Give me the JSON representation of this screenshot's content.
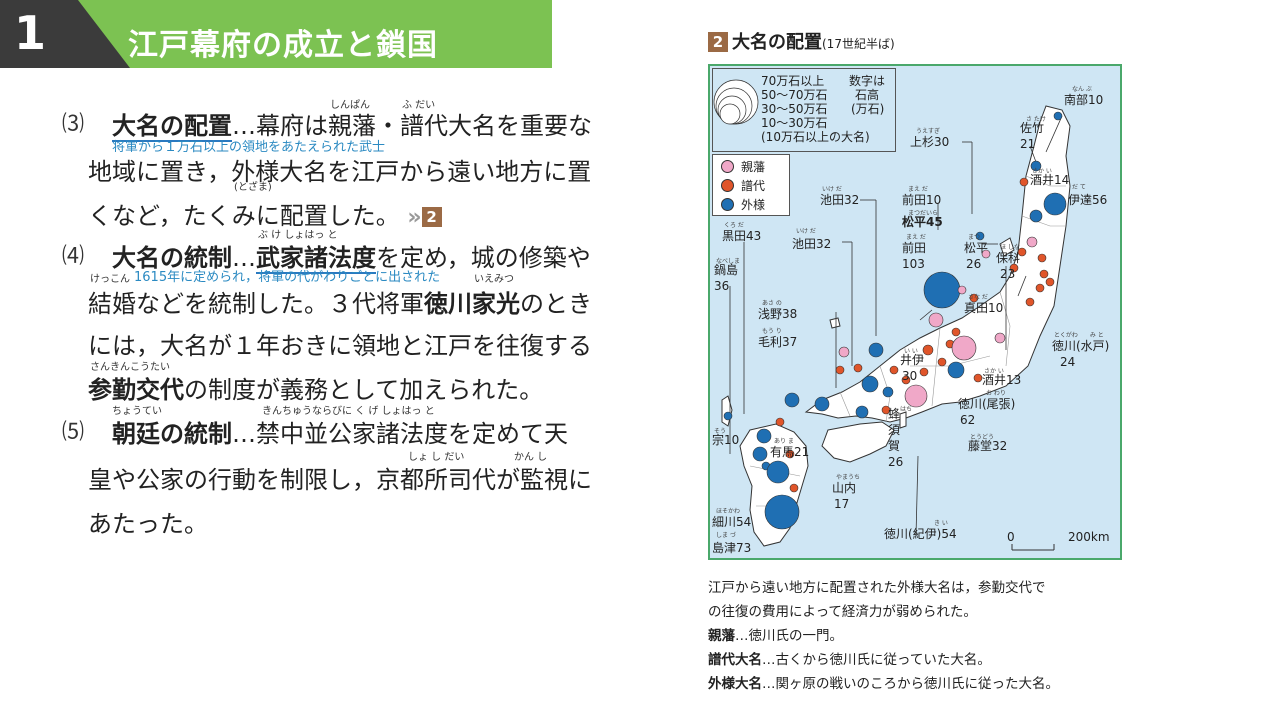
{
  "header": {
    "number": "1",
    "title": "江戸幕府の成立と鎖国"
  },
  "body": {
    "p3": {
      "num": "⑶",
      "head": "大名の配置",
      "l1_rest_a": "…幕府は",
      "shinpan": "親藩",
      "l1_mid": "・",
      "fudai": "譜代",
      "l1_rest_b": "大名を重要な",
      "ruby_shinpan": "しんぱん",
      "ruby_fudai": "ふ だい",
      "note_fudai": "将軍から１万石以上の領地をあたえられた武士",
      "l2_a": "地域に置き，",
      "tozama": "外様",
      "l2_b": "大名を江戸から遠い地方に置",
      "ruby_tozama": "(とざま)",
      "l3": "くなど，たくみに配置した。",
      "ref_arrow": "»",
      "ref_num": "2"
    },
    "p4": {
      "num": "⑷",
      "head": "大名の統制",
      "dots": "…",
      "bukeshohatto": "武家諸法度",
      "ruby_buke": "ぶ け しょはっ と",
      "l1_rest": "を定め，城の修築や",
      "ruby_kekkon": "けっこん",
      "note_buke": "1615年に定められ，将軍の代がわりごとに出された",
      "ruby_iemitsu": "いえみつ",
      "l2_a": "結婚などを統制した。３代将軍",
      "iemitsu": "徳川家光",
      "l2_b": "のとき",
      "l3": "には，大名が１年おきに領地と江戸を往復する",
      "ruby_sankin": "さんきんこうたい",
      "sankin": "参勤交代",
      "l4_rest": "の制度が義務として加えられた。"
    },
    "p5": {
      "num": "⑸",
      "ruby_chotei": "ちょうてい",
      "head": "朝廷の統制",
      "dots": "…",
      "l1_rest": "禁中並公家諸法度を定めて天",
      "ruby_kinchu": "きんちゅうならびに く げ しょはっ と",
      "l2": "皇や公家の行動を制限し，京都所司代が監視に",
      "ruby_shoshidai": "しょ し だい",
      "ruby_kanshi": "かん し",
      "l3": "あたった。"
    }
  },
  "figure": {
    "num": "2",
    "title": "大名の配置",
    "subtitle": "(17世紀半ば)",
    "legend_size": [
      "70万石以上",
      "50〜70万石",
      "30〜50万石",
      "10〜30万石",
      "(10万石以上の大名)"
    ],
    "legend_note": [
      "数字は",
      "石高",
      "(万石)"
    ],
    "legend_types": [
      {
        "label": "親藩",
        "color": "#f0a8c8"
      },
      {
        "label": "譜代",
        "color": "#e0552a"
      },
      {
        "label": "外様",
        "color": "#1f6fb3"
      }
    ],
    "labels": {
      "nanbu": "南部10",
      "satake": "佐竹",
      "satake_n": "21",
      "sakai14": "酒井14",
      "date": "伊達56",
      "uesugi": "上杉30",
      "maeda10": "前田10",
      "matsudaira45": "松平45",
      "ikeda32a": "池田32",
      "kuroda": "黒田43",
      "ikeda32b": "池田32",
      "maeda103": "前田",
      "maeda103_n": "103",
      "matsudaira26": "松平",
      "matsudaira26_n": "26",
      "hoshina": "保科",
      "hoshina_n": "23",
      "nabeshima": "鍋島",
      "nabeshima_n": "36",
      "sanada": "真田10",
      "asano": "浅野38",
      "mori": "毛利37",
      "ii": "井伊",
      "ii_n": "30",
      "mito": "徳川(水戸)",
      "mito_n": "24",
      "sakai13": "酒井13",
      "owari": "徳川(尾張)",
      "owari_n": "62",
      "hachisuka": "蜂",
      "hachisuka2": "須",
      "hachisuka3": "賀",
      "hachisuka_n": "26",
      "so": "宗10",
      "arima": "有馬21",
      "todo": "藤堂32",
      "yamauchi": "山内",
      "yamauchi_n": "17",
      "hosokawa": "細川54",
      "kii": "徳川(紀伊)54",
      "shimazu": "島津73",
      "scale0": "0",
      "scale200": "200km"
    },
    "ruby": {
      "nanbu": "なん ぶ",
      "satake": "さ たけ",
      "sakai14": "さか い",
      "date": "だ て",
      "uesugi": "うえすぎ",
      "maeda10": "まえ だ",
      "matsudaira45": "まつだいら",
      "ikeda32a": "いけ だ",
      "kuroda": "くろ だ",
      "ikeda32b": "いけ だ",
      "maeda103": "まえ だ",
      "matsudaira26": "まつ",
      "hoshina": "ほ しな",
      "nabeshima": "なべしま",
      "sanada": "さな だ",
      "asano": "あさ の",
      "mori": "もう り",
      "ii": "い い",
      "mito": "とくがわ　　み と",
      "sakai13": "さか い",
      "owari": "お わり",
      "hachisuka": "はち",
      "so": "そう",
      "arima": "あり ま",
      "todo": "とうどう",
      "yamauchi": "やまうち",
      "hosokawa": "ほそかわ",
      "kii": "き い",
      "shimazu": "しま づ"
    }
  },
  "caption": {
    "l1": "江戸から遠い地方に配置された外様大名は，参勤交代で",
    "l2": "の往復の費用によって経済力が弱められた。",
    "shinpan_b": "親藩",
    "shinpan_t": "…徳川氏の一門。",
    "fudai_b": "譜代大名",
    "fudai_t": "…古くから徳川氏に従っていた大名。",
    "tozama_b": "外様大名",
    "tozama_t": "…関ヶ原の戦いのころから徳川氏に従った大名。"
  }
}
